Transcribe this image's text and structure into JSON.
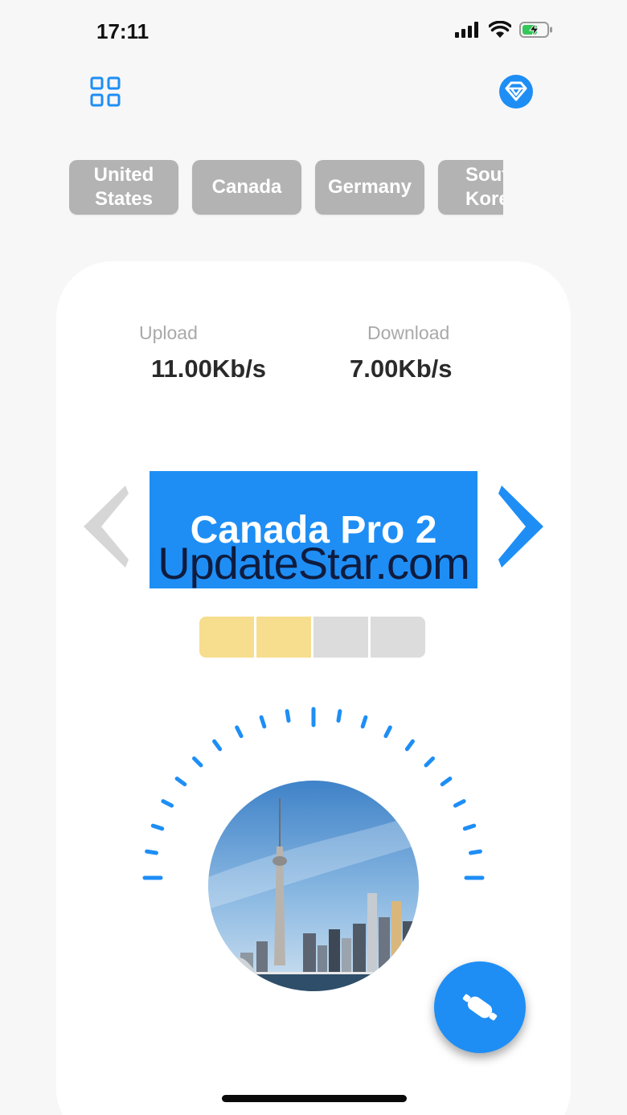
{
  "status_bar": {
    "time": "17:11"
  },
  "header": {
    "menu_icon": "grid-icon",
    "premium_icon": "diamond-icon"
  },
  "countries": [
    "United States",
    "Canada",
    "Germany",
    "South Korea"
  ],
  "stats": {
    "upload_label": "Upload",
    "upload_value": "11.00Kb/s",
    "download_label": "Download",
    "download_value": "7.00Kb/s"
  },
  "server": {
    "name": "Canada Pro 2",
    "watermark": "UpdateStar.com",
    "prev_icon": "chevron-left-icon",
    "next_icon": "chevron-right-icon"
  },
  "signal": {
    "bars_total": 4,
    "bars_active": 2,
    "active_color": "#f7de8e"
  },
  "colors": {
    "accent": "#1e8ef5",
    "chip": "#b3b3b3"
  },
  "connect_button": {
    "icon": "plug-icon"
  }
}
